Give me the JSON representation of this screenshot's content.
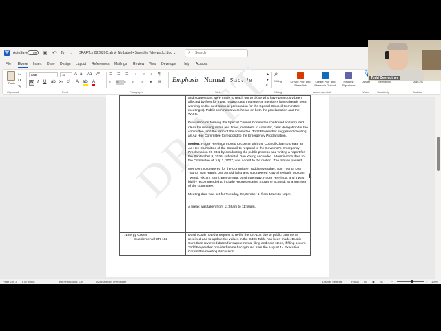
{
  "titlebar": {
    "autosave_label": "AutoSave",
    "autosave_state": "Off",
    "doc_title": "DRAFTcm082820C.ah  ⊘ No Label • Saved to \\\\devwa.lcf.doc ⌄",
    "search_placeholder": "Search"
  },
  "menu": [
    "File",
    "Home",
    "Insert",
    "Draw",
    "Design",
    "Layout",
    "References",
    "Mailings",
    "Review",
    "View",
    "Developer",
    "Help",
    "Acrobat"
  ],
  "ribbon": {
    "paste": "Paste",
    "font_name": "Arial",
    "font_size": "11",
    "styles": [
      "Emphasis",
      "Normal",
      "Subtitle"
    ],
    "editing": "Editing",
    "create_pdf": "Create PDF and Share link",
    "create_pdf_outlook": "Create PDF and Share via Outlook",
    "request_signatures": "Request Signatures",
    "dictate": "Dictate",
    "sensitivity": "Sensitivity",
    "addins": "Add-ins",
    "groups": [
      "Clipboard",
      "Font",
      "Paragraph",
      "Styles",
      "Editing",
      "Adobe Acrobat",
      "Voice",
      "Sensitivity",
      "Add-ins"
    ]
  },
  "document": {
    "watermark": "DRAFT",
    "row1_paragraphs": [
      "and suggestions were made to reach out to those who have previously been affected by fires for input.  It was noted that several members have already been working on the next steps in preparation for the Special Council Committee meeting(s).  Public comments were heard on both the proclamation and the WUIC.",
      "Discussion on forming the Special Council Committee continued and included ideas for meeting dates and times, members to consider, clear delegation for the committee, and the term of the committee.  Todd Beyreuther suggested creating an Ad Hoc Committee to respond to the Emergency Proclamation.",
      "Roger Heeringa moved to concur with the Council Chair to create an Ad Hoc Committee of the Council to respond to the Governor's Emergency Proclamation 26-03.1 by conducting the public process and writing a report for the September 9, 2026, submittal, Dan Young seconded.  A termination date for the Committee of July 1, 2027, was added to the motion.  The motion passed.",
      "Members volunteered for the Committee:  Todd Beyreuther, Tom Young, Dan Young, Tom Handy, Jay Arnold (who also volunteered Katy Sheehan), Morgan Tweed, Vikram Sami, Ben Omura, Justin Benway, Roger Heeringa, and it was highly recommended to include Representative Suzanne Schmidt as a member of the committee.",
      "Meeting date was set for Tuesday, September 1, from 10am to 12pm.",
      "A break was taken from 11:36am to 11:50am."
    ],
    "motion_label": "Motion:",
    "row2_item": "7. Energy Codes",
    "row2_bullet": "Supplemental CR-102",
    "row2_text": "Dustin Curb noted a request to re-file the CR-102 due to public comments received and to update the values in the C406 Table has been made.  Dustin Curb then reviewed dates for supplemental filing and next steps, if filing occurs.  Todd Beyreuther provided some background from the August 14 Executive Committee meeting discussion."
  },
  "statusbar": {
    "page": "Page 2 of 3",
    "words": "875 words",
    "text_predictions": "Text Predictions: On",
    "accessibility": "Accessibility: Investigate",
    "display_settings": "Display Settings",
    "focus": "Focus",
    "zoom": "120%"
  },
  "webcam": {
    "name": "Todd Beyreuther"
  }
}
